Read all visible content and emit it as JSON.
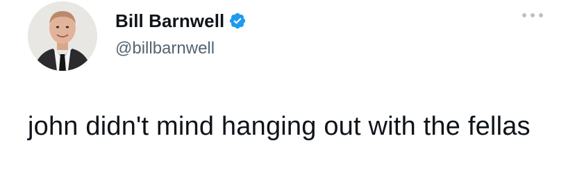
{
  "author": {
    "display_name": "Bill Barnwell",
    "handle": "@billbarnwell",
    "verified": true,
    "avatar_icon": "profile-photo"
  },
  "menu": {
    "icon": "more-options-icon"
  },
  "tweet": {
    "text": "john didn't mind hanging out with the fellas"
  },
  "colors": {
    "verified_blue": "#1d9bf0",
    "handle_gray": "#536471",
    "text": "#0f1419"
  }
}
